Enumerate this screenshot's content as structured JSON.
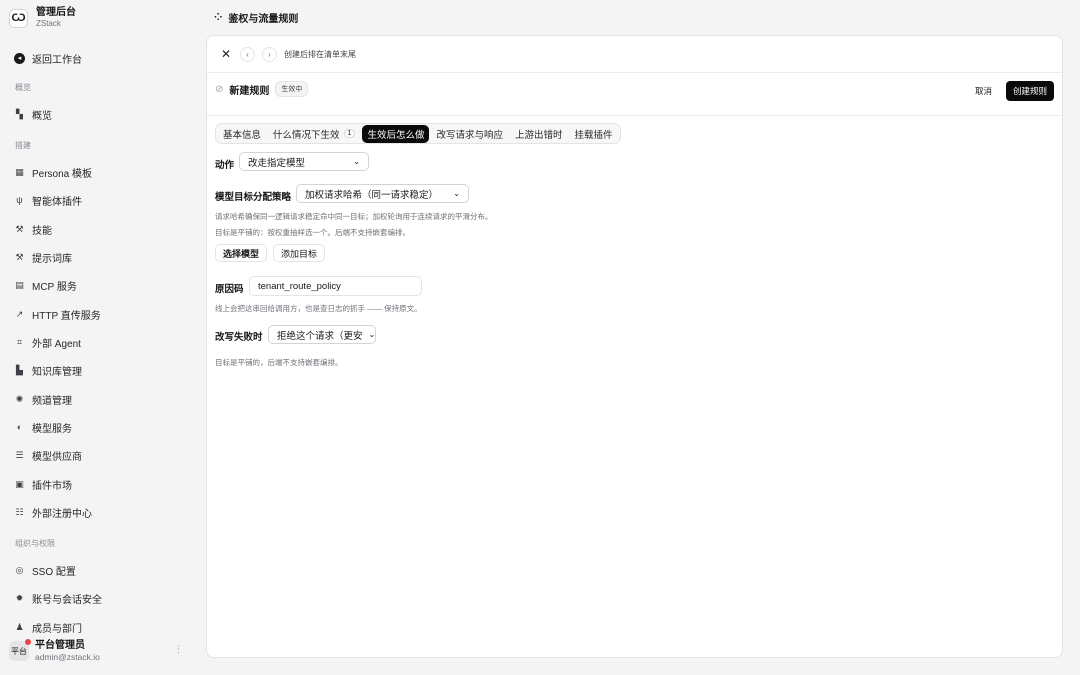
{
  "brand": {
    "title": "管理后台",
    "subtitle": "ZStack",
    "logo_icon": "brand-logo-icon"
  },
  "nav": {
    "back": "返回工作台",
    "sections": {
      "overview": "概览",
      "build": "搭建",
      "org": "组织与权限"
    },
    "items": [
      {
        "label": "概览",
        "icon": "grid-icon"
      },
      {
        "label": "Persona 模板",
        "icon": "template-icon"
      },
      {
        "label": "智能体插件",
        "icon": "plug-icon"
      },
      {
        "label": "技能",
        "icon": "tool-icon"
      },
      {
        "label": "提示词库",
        "icon": "prompt-icon"
      },
      {
        "label": "MCP 服务",
        "icon": "server-icon"
      },
      {
        "label": "HTTP 直传服务",
        "icon": "http-icon"
      },
      {
        "label": "外部 Agent",
        "icon": "agent-icon"
      },
      {
        "label": "知识库管理",
        "icon": "book-icon"
      },
      {
        "label": "频道管理",
        "icon": "channel-icon"
      },
      {
        "label": "模型服务",
        "icon": "model-icon"
      },
      {
        "label": "模型供应商",
        "icon": "provider-icon"
      },
      {
        "label": "插件市场",
        "icon": "market-icon"
      },
      {
        "label": "外部注册中心",
        "icon": "registry-icon"
      },
      {
        "label": "SSO 配置",
        "icon": "sso-icon"
      },
      {
        "label": "账号与会话安全",
        "icon": "security-icon"
      },
      {
        "label": "成员与部门",
        "icon": "members-icon"
      }
    ]
  },
  "user": {
    "avatar": "平台",
    "name": "平台管理员",
    "email": "admin@zstack.io"
  },
  "page": {
    "title": "鉴权与流量规则"
  },
  "topbar": {
    "hint": "创建后排在清单末尾"
  },
  "rule": {
    "title": "新建规则",
    "status": "生效中",
    "cancel": "取消",
    "create": "创建规则"
  },
  "tabs": [
    {
      "label": "基本信息"
    },
    {
      "label": "什么情况下生效",
      "count": "1"
    },
    {
      "label": "生效后怎么做",
      "active": true
    },
    {
      "label": "改写请求与响应"
    },
    {
      "label": "上游出错时"
    },
    {
      "label": "挂载插件"
    }
  ],
  "form": {
    "action_label": "动作",
    "action_value": "改走指定模型",
    "strategy_label": "模型目标分配策略",
    "strategy_value": "加权请求哈希（同一请求稳定）",
    "strategy_hint1": "请求哈希确保同一逻辑请求稳定命中同一目标；加权轮询用于连续请求的平滑分布。",
    "strategy_hint2": "目标是平铺的：按权重抽样选一个。后端不支持嵌套编排。",
    "select_model": "选择模型",
    "add_target": "添加目标",
    "reason_label": "原因码",
    "reason_value": "tenant_route_policy",
    "reason_hint": "线上会把这串回给调用方，也是查日志的抓手 —— 保持原文。",
    "fail_label": "改写失败时",
    "fail_value": "拒绝这个请求（更安",
    "fail_hint": "目标是平铺的，后端不支持嵌套编排。"
  }
}
